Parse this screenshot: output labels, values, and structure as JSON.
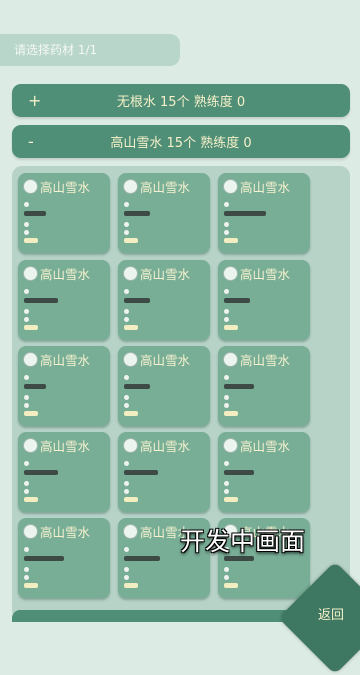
{
  "header": {
    "prompt": "请选择药材 1/1"
  },
  "categories": [
    {
      "sign": "+",
      "label": "无根水 15个  熟练度 0"
    },
    {
      "sign": "-",
      "label": "高山雪水 15个  熟练度 0"
    }
  ],
  "items": [
    {
      "name": "高山雪水",
      "icon": "herb-icon"
    },
    {
      "name": "高山雪水",
      "icon": "herb-icon"
    },
    {
      "name": "高山雪水",
      "icon": "herb-icon"
    },
    {
      "name": "高山雪水",
      "icon": "herb-icon"
    },
    {
      "name": "高山雪水",
      "icon": "herb-icon"
    },
    {
      "name": "高山雪水",
      "icon": "herb-icon"
    },
    {
      "name": "高山雪水",
      "icon": "herb-icon"
    },
    {
      "name": "高山雪水",
      "icon": "herb-icon"
    },
    {
      "name": "高山雪水",
      "icon": "herb-icon"
    },
    {
      "name": "高山雪水",
      "icon": "herb-icon"
    },
    {
      "name": "高山雪水",
      "icon": "herb-icon"
    },
    {
      "name": "高山雪水",
      "icon": "herb-icon"
    },
    {
      "name": "高山雪水",
      "icon": "herb-icon"
    },
    {
      "name": "高山雪水",
      "icon": "herb-icon"
    },
    {
      "name": "高山雪水",
      "icon": "herb-icon"
    }
  ],
  "overlay": {
    "text": "开发中画面"
  },
  "footer": {
    "back_label": "返回"
  },
  "colors": {
    "accent": "#4f8e77",
    "card": "#78ad96",
    "text_light": "#f6f1c9"
  }
}
